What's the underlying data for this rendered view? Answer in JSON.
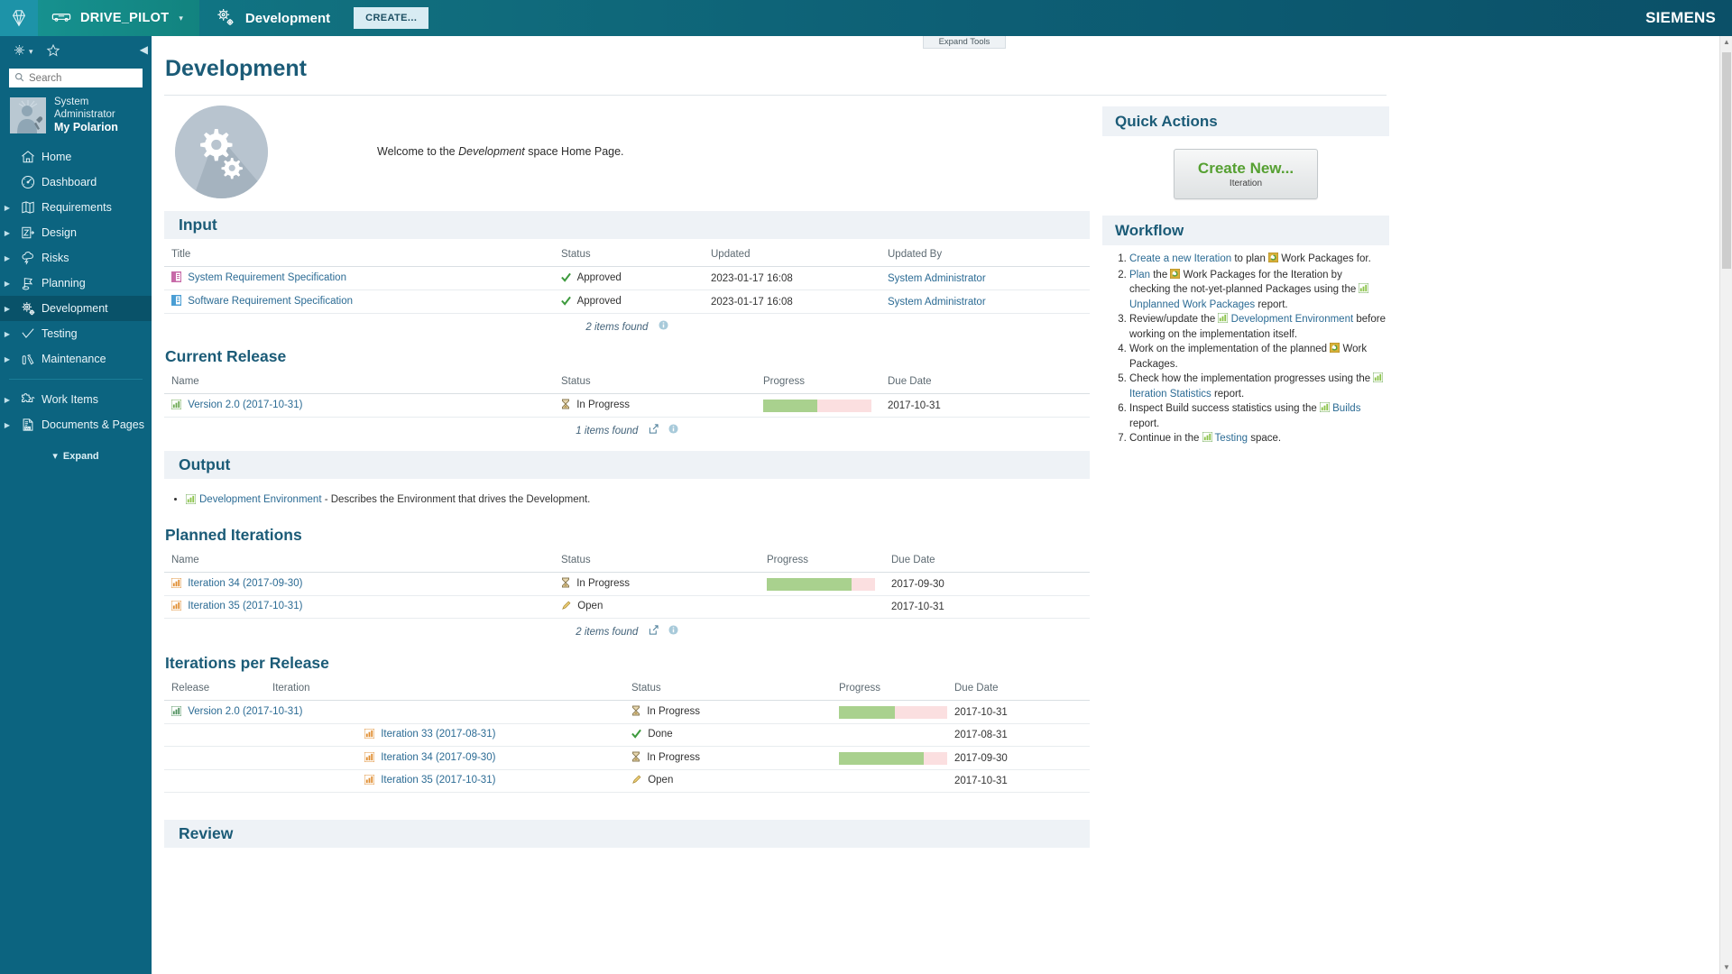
{
  "topbar": {
    "logo_icon": "polarion-diamond-icon",
    "project_icon": "car-icon",
    "project_name": "DRIVE_PILOT",
    "project_caret": "▾",
    "space_icon": "gears-icon",
    "space_name": "Development",
    "create_label": "CREATE...",
    "brand": "SIEMENS"
  },
  "sidebar": {
    "gear_icon": "gear-icon",
    "gear_caret": "▾",
    "star_icon": "star-icon",
    "collapse_icon": "collapse-left-icon",
    "search": {
      "icon": "search-icon",
      "placeholder": "Search",
      "value": ""
    },
    "user": {
      "avatar_icon": "user-avatar-icon",
      "name": "System Administrator",
      "portal": "My Polarion"
    },
    "items": [
      {
        "label": "Home",
        "icon": "home-icon",
        "expandable": false,
        "active": false
      },
      {
        "label": "Dashboard",
        "icon": "dashboard-gauge-icon",
        "expandable": false,
        "active": false
      },
      {
        "label": "Requirements",
        "icon": "requirements-map-icon",
        "expandable": true,
        "active": false
      },
      {
        "label": "Design",
        "icon": "design-icon",
        "expandable": true,
        "active": false
      },
      {
        "label": "Risks",
        "icon": "risks-cloud-icon",
        "expandable": true,
        "active": false
      },
      {
        "label": "Planning",
        "icon": "planning-flag-icon",
        "expandable": true,
        "active": false
      },
      {
        "label": "Development",
        "icon": "development-gears-icon",
        "expandable": true,
        "active": true
      },
      {
        "label": "Testing",
        "icon": "testing-check-icon",
        "expandable": true,
        "active": false
      },
      {
        "label": "Maintenance",
        "icon": "maintenance-tools-icon",
        "expandable": true,
        "active": false
      }
    ],
    "items2": [
      {
        "label": "Work Items",
        "icon": "work-items-puzzle-icon",
        "expandable": true,
        "active": false
      },
      {
        "label": "Documents & Pages",
        "icon": "documents-pages-icon",
        "expandable": true,
        "active": false
      }
    ],
    "expand_caret": "▾",
    "expand_label": "Expand"
  },
  "main": {
    "expand_tools_label": "Expand Tools",
    "page_title": "Development",
    "welcome_icon": "gears-circle-image",
    "welcome_prefix": "Welcome to the ",
    "welcome_em": "Development",
    "welcome_suffix": " space Home Page."
  },
  "input_section": {
    "title": "Input",
    "columns": [
      "Title",
      "Status",
      "Updated",
      "Updated By"
    ],
    "rows": [
      {
        "icon": "document-pink-icon",
        "title": "System Requirement Specification",
        "status_icon": "check-green-icon",
        "status": "Approved",
        "updated": "2023-01-17 16:08",
        "updated_by": "System Administrator"
      },
      {
        "icon": "document-blue-icon",
        "title": "Software Requirement Specification",
        "status_icon": "check-green-icon",
        "status": "Approved",
        "updated": "2023-01-17 16:08",
        "updated_by": "System Administrator"
      }
    ],
    "items_found": "2 items found",
    "info_icon": "info-icon"
  },
  "current_release": {
    "title": "Current Release",
    "columns": [
      "Name",
      "Status",
      "Progress",
      "Due Date"
    ],
    "rows": [
      {
        "icon": "chart-green-icon",
        "name": "Version 2.0 (2017-10-31)",
        "status_icon": "hourglass-icon",
        "status": "In Progress",
        "progress_pct": 50,
        "due_date": "2017-10-31"
      }
    ],
    "items_found": "1 items found",
    "export_icon": "export-icon",
    "info_icon": "info-icon"
  },
  "output_section": {
    "title": "Output",
    "items": [
      {
        "icon": "chart-green-icon",
        "link": "Development Environment",
        "text": " - Describes the Environment that drives the Development."
      }
    ]
  },
  "planned_iterations": {
    "title": "Planned Iterations",
    "columns": [
      "Name",
      "Status",
      "Progress",
      "Due Date"
    ],
    "rows": [
      {
        "icon": "chart-orange-icon",
        "name": "Iteration 34 (2017-09-30)",
        "status_icon": "hourglass-icon",
        "status": "In Progress",
        "progress_pct": 78,
        "due_date": "2017-09-30"
      },
      {
        "icon": "chart-orange-icon",
        "name": "Iteration 35 (2017-10-31)",
        "status_icon": "pencil-icon",
        "status": "Open",
        "progress_pct": null,
        "due_date": "2017-10-31"
      }
    ],
    "items_found": "2 items found",
    "export_icon": "export-icon",
    "info_icon": "info-icon"
  },
  "iterations_per_release": {
    "title": "Iterations per Release",
    "columns": [
      "Release",
      "Iteration",
      "Status",
      "Progress",
      "Due Date"
    ],
    "rows": [
      {
        "indent": 0,
        "icon": "chart-green-icon",
        "release": "Version 2.0 (2017-10-31)",
        "iteration": "",
        "status_icon": "hourglass-icon",
        "status": "In Progress",
        "progress_pct": 52,
        "due_date": "2017-10-31",
        "struck": false
      },
      {
        "indent": 1,
        "icon": "chart-orange-icon",
        "release": "",
        "iteration": "Iteration 33 (2017-08-31)",
        "status_icon": "check-green-icon",
        "status": "Done",
        "progress_pct": null,
        "due_date": "2017-08-31",
        "struck": true
      },
      {
        "indent": 1,
        "icon": "chart-orange-icon",
        "release": "",
        "iteration": "Iteration 34 (2017-09-30)",
        "status_icon": "hourglass-icon",
        "status": "In Progress",
        "progress_pct": 78,
        "due_date": "2017-09-30",
        "struck": false
      },
      {
        "indent": 1,
        "icon": "chart-orange-icon",
        "release": "",
        "iteration": "Iteration 35 (2017-10-31)",
        "status_icon": "pencil-icon",
        "status": "Open",
        "progress_pct": null,
        "due_date": "2017-10-31",
        "struck": false
      }
    ]
  },
  "review_section": {
    "title": "Review"
  },
  "quick_actions": {
    "title": "Quick Actions",
    "button_label": "Create New...",
    "button_sub": "Iteration"
  },
  "workflow": {
    "title": "Workflow",
    "steps": [
      {
        "parts": [
          {
            "t": "link",
            "v": "Create a new Iteration"
          },
          {
            "t": "text",
            "v": " to plan "
          },
          {
            "t": "icon",
            "v": "work-package-icon"
          },
          {
            "t": "text",
            "v": " Work Packages for."
          }
        ]
      },
      {
        "parts": [
          {
            "t": "link",
            "v": "Plan"
          },
          {
            "t": "text",
            "v": " the "
          },
          {
            "t": "icon",
            "v": "work-package-icon"
          },
          {
            "t": "text",
            "v": " Work Packages for the Iteration by checking the not-yet-planned Packages using the "
          },
          {
            "t": "icon",
            "v": "report-icon"
          },
          {
            "t": "link",
            "v": " Unplanned Work Packages"
          },
          {
            "t": "text",
            "v": " report."
          }
        ]
      },
      {
        "parts": [
          {
            "t": "text",
            "v": "Review/update the "
          },
          {
            "t": "icon",
            "v": "report-icon"
          },
          {
            "t": "link",
            "v": " Development Environment"
          },
          {
            "t": "text",
            "v": " before working on the implementation itself."
          }
        ]
      },
      {
        "parts": [
          {
            "t": "text",
            "v": "Work on the implementation of the planned "
          },
          {
            "t": "icon",
            "v": "work-package-icon"
          },
          {
            "t": "text",
            "v": " Work Packages."
          }
        ]
      },
      {
        "parts": [
          {
            "t": "text",
            "v": "Check how the implementation progresses using the "
          },
          {
            "t": "icon",
            "v": "report-icon"
          },
          {
            "t": "link",
            "v": " Iteration Statistics"
          },
          {
            "t": "text",
            "v": " report."
          }
        ]
      },
      {
        "parts": [
          {
            "t": "text",
            "v": "Inspect Build success statistics using the "
          },
          {
            "t": "icon",
            "v": "report-icon"
          },
          {
            "t": "link",
            "v": " Builds"
          },
          {
            "t": "text",
            "v": " report."
          }
        ]
      },
      {
        "parts": [
          {
            "t": "text",
            "v": "Continue in the "
          },
          {
            "t": "icon",
            "v": "report-icon"
          },
          {
            "t": "link",
            "v": " Testing"
          },
          {
            "t": "text",
            "v": " space."
          }
        ]
      }
    ]
  },
  "colors": {
    "brand_teal": "#0c6480",
    "heading_blue": "#1b5b77",
    "link_blue": "#2b6b94",
    "progress_done": "#a9d18e",
    "progress_remaining": "#fbdfe0",
    "create_green": "#56a032"
  }
}
